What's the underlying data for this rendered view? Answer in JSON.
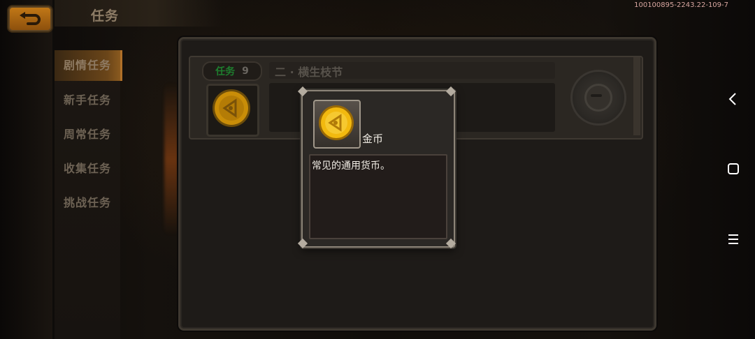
{
  "header": {
    "title": "任务",
    "version": "100100895-2243.22-109-7"
  },
  "side_menu": {
    "items": [
      {
        "label": "剧情任务",
        "active": true
      },
      {
        "label": "新手任务",
        "active": false
      },
      {
        "label": "周常任务",
        "active": false
      },
      {
        "label": "收集任务",
        "active": false
      },
      {
        "label": "挑战任务",
        "active": false
      }
    ]
  },
  "task": {
    "tag_label": "任务",
    "tag_number": "9",
    "name": "二 · 横生枝节",
    "reward_icon": "gold-coin-icon"
  },
  "tooltip": {
    "item_icon": "gold-coin-icon",
    "item_name": "金币",
    "description": "常见的通用货币。"
  },
  "nav": {
    "icons": [
      "back-chevron-icon",
      "home-square-icon",
      "menu-lines-icon"
    ]
  },
  "colors": {
    "accent_orange": "#c47a17",
    "tag_green": "#1e7d2e",
    "coin_gold": "#f2b90f"
  }
}
